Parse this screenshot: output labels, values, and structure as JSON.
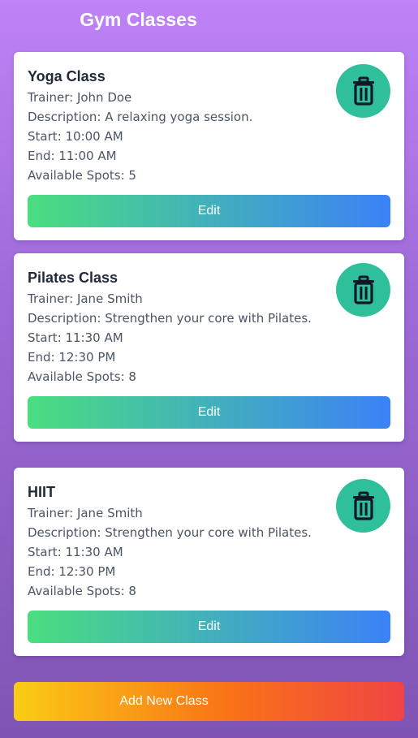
{
  "header": {
    "title": "Gym Classes"
  },
  "classes": [
    {
      "name": "Yoga Class",
      "trainer": "Trainer: John Doe",
      "description": "Description: A relaxing yoga session.",
      "start": "Start: 10:00 AM",
      "end": "End: 11:00 AM",
      "spots": "Available Spots: 5",
      "edit_label": "Edit",
      "delete_icon": "trash-icon"
    },
    {
      "name": "Pilates Class",
      "trainer": "Trainer: Jane Smith",
      "description": "Description: Strengthen your core with Pilates.",
      "start": "Start: 11:30 AM",
      "end": "End: 12:30 PM",
      "spots": "Available Spots: 8",
      "edit_label": "Edit",
      "delete_icon": "trash-icon"
    },
    {
      "name": "HIIT",
      "trainer": "Trainer: Jane Smith",
      "description": "Description: Strengthen your core with Pilates.",
      "start": "Start: 11:30 AM",
      "end": "End: 12:30 PM",
      "spots": "Available Spots: 8",
      "edit_label": "Edit",
      "delete_icon": "trash-icon"
    }
  ],
  "footer": {
    "add_label": "Add New Class"
  },
  "colors": {
    "delete_button": "#2fbf9b",
    "edit_gradient_start": "#4ade80",
    "edit_gradient_end": "#3b82f6",
    "add_gradient_start": "#facc15",
    "add_gradient_end": "#ef4444"
  }
}
